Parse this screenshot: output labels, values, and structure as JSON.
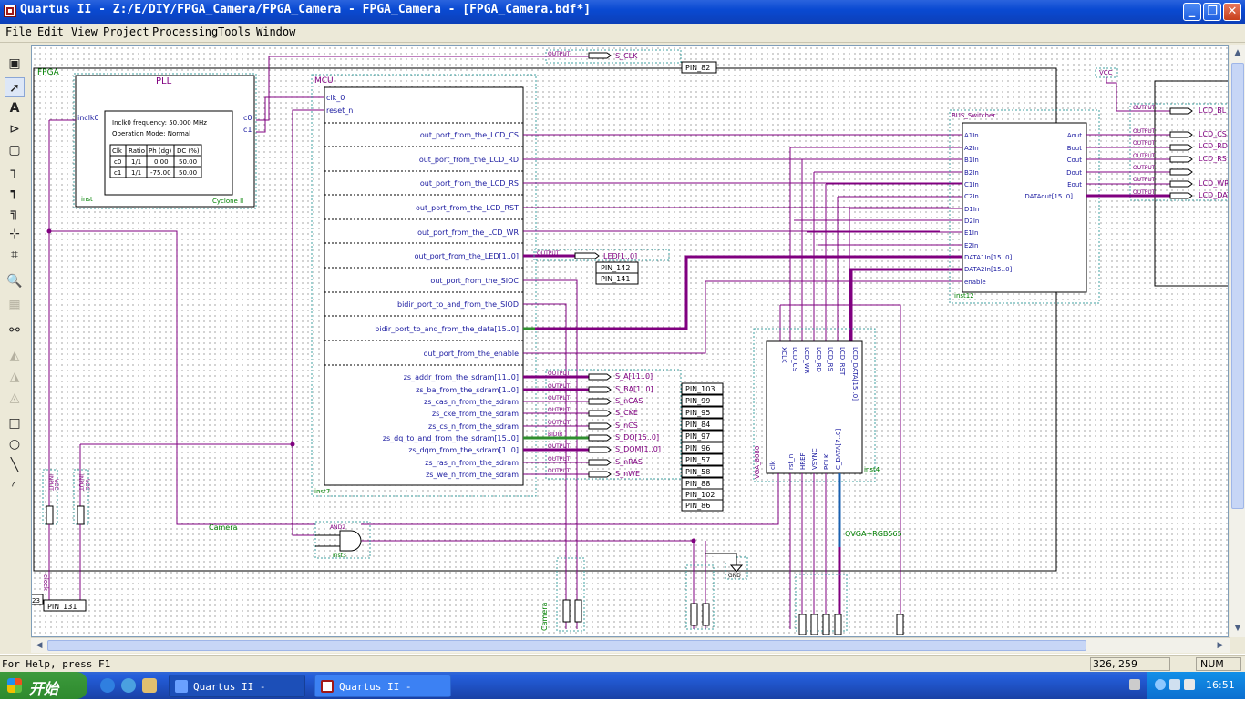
{
  "window": {
    "title": "Quartus II - Z:/E/DIY/FPGA_Camera/FPGA_Camera - FPGA_Camera - [FPGA_Camera.bdf*]",
    "buttons": {
      "minimize": "_",
      "maximize": "❐",
      "close": "✕"
    }
  },
  "menu": [
    "File",
    "Edit",
    "View",
    "Project",
    "Processing",
    "Tools",
    "Window"
  ],
  "tools": [
    "select-icon",
    "text-icon",
    "symbol-icon",
    "block-icon",
    "orthogonal-node-icon",
    "orthogonal-bus-icon",
    "conduit-icon",
    "rubberbanding-icon",
    "partial-line-icon",
    "zoom-icon",
    "fullscreen-icon",
    "find-icon",
    "flip-horizontal-icon",
    "flip-vertical-icon",
    "rotate-icon",
    "rectangle-icon",
    "circle-icon",
    "line-icon",
    "arc-icon"
  ],
  "schematic": {
    "fpga_label": "FPGA",
    "pll": {
      "name": "PLL",
      "input": "inclk0",
      "freq": "Inclk0 frequency: 50.000 MHz",
      "mode": "Operation Mode: Normal",
      "headers": [
        "Clk",
        "Ratio",
        "Ph (dg)",
        "DC (%)"
      ],
      "rows": [
        [
          "c0",
          "1/1",
          "0.00",
          "50.00"
        ],
        [
          "c1",
          "1/1",
          "-75.00",
          "50.00"
        ]
      ],
      "outputs": [
        "c0",
        "c1"
      ],
      "inst": "inst",
      "device": "Cyclone II"
    },
    "mcu": {
      "name": "MCU",
      "inputs": [
        "clk_0",
        "reset_n"
      ],
      "ports": [
        "out_port_from_the_LCD_CS",
        "out_port_from_the_LCD_RD",
        "out_port_from_the_LCD_RS",
        "out_port_from_the_LCD_RST",
        "out_port_from_the_LCD_WR",
        "out_port_from_the_LED[1..0]",
        "out_port_from_the_SIOC",
        "bidir_port_to_and_from_the_SIOD",
        "bidir_port_to_and_from_the_data[15..0]",
        "out_port_from_the_enable"
      ],
      "sdram_ports": [
        "zs_addr_from_the_sdram[11..0]",
        "zs_ba_from_the_sdram[1..0]",
        "zs_cas_n_from_the_sdram",
        "zs_cke_from_the_sdram",
        "zs_cs_n_from_the_sdram",
        "zs_dq_to_and_from_the_sdram[15..0]",
        "zs_dqm_from_the_sdram[1..0]",
        "zs_ras_n_from_the_sdram",
        "zs_we_n_from_the_sdram"
      ],
      "inst": "inst7"
    },
    "sclk": {
      "type": "OUTPUT",
      "name": "S_CLK",
      "pin": "PIN_82"
    },
    "led": {
      "type": "OUTPUT",
      "name": "LED[1..0]",
      "pins": [
        "PIN_142",
        "PIN_141"
      ]
    },
    "sdram_pins": [
      {
        "type": "OUTPUT",
        "name": "S_A[11..0]",
        "pin": "PIN_103"
      },
      {
        "type": "OUTPUT",
        "name": "S_BA[1..0]",
        "pin": "PIN_99"
      },
      {
        "type": "OUTPUT",
        "name": "S_nCAS",
        "pin": "PIN_95"
      },
      {
        "type": "OUTPUT",
        "name": "S_CKE",
        "pin": "PIN_84"
      },
      {
        "type": "OUTPUT",
        "name": "S_nCS",
        "pin": "PIN_97"
      },
      {
        "type": "BIDIR",
        "name": "S_DQ[15..0]",
        "pin": "PIN_96"
      },
      {
        "type": "OUTPUT",
        "name": "S_DQM[1..0]",
        "pin": "PIN_57"
      },
      {
        "type": "OUTPUT",
        "name": "S_nRAS",
        "pin": "PIN_58"
      },
      {
        "type": "OUTPUT",
        "name": "S_nWE",
        "pin": "PIN_88"
      }
    ],
    "extra_pins": [
      "PIN_102",
      "PIN_86"
    ],
    "bus_switcher": {
      "name": "BUS_Switcher",
      "inputs": [
        "A1In",
        "A2In",
        "B1In",
        "B2In",
        "C1In",
        "C2In",
        "D1In",
        "D2In",
        "E1In",
        "E2In",
        "DATA1In[15..0]",
        "DATA2In[15..0]",
        "enable"
      ],
      "outputs": [
        "Aout",
        "Bout",
        "Cout",
        "Dout",
        "Eout",
        "DATAout[15..0]"
      ],
      "inst": "inst12"
    },
    "vcc": "VCC",
    "lcd_outputs": [
      "LCD_BL",
      "LCD_CS",
      "LCD_RD",
      "LCD_RS",
      "LCD_WR",
      "LCD_DATA"
    ],
    "output_tag": "OUTPUT",
    "vga": {
      "name": "VGA_8080",
      "top_ports": [
        "XCLK",
        "LCD_CS",
        "LCD_WR",
        "LCD_RD",
        "LCD_RS",
        "LCD_RST",
        "LCD_DATA[15..0]"
      ],
      "bottom_ports": [
        "clk",
        "rst_n",
        "HREF",
        "VSYNC",
        "PCLK",
        "C_DATA[7..0]"
      ],
      "inst": "inst4"
    },
    "and2": {
      "name": "AND2",
      "inst": "inst3"
    },
    "camera_label": "Camera",
    "qvga_label": "QVGA+RGB565",
    "gnd": "GND",
    "input_tag": "INPUT",
    "input_vcc": "VCC",
    "clock_label": "clock",
    "clock_pin": "PIN_131",
    "pin_partial": "23",
    "camera_bottom_label": "Camera"
  },
  "status": {
    "help": "For Help, press F1",
    "coords": "326, 259",
    "num": "NUM"
  },
  "taskbar": {
    "start": "开始",
    "tasks": [
      "Quartus II - Z:/...",
      "Quartus II - Z:/..."
    ],
    "clock": "16:51"
  },
  "colors": {
    "wire": "#800080",
    "bus": "#800080",
    "bus_green": "#2f8f2f",
    "text": "#1a1aa0",
    "symbol_text": "#008000",
    "dotted": "#40a0a0"
  }
}
